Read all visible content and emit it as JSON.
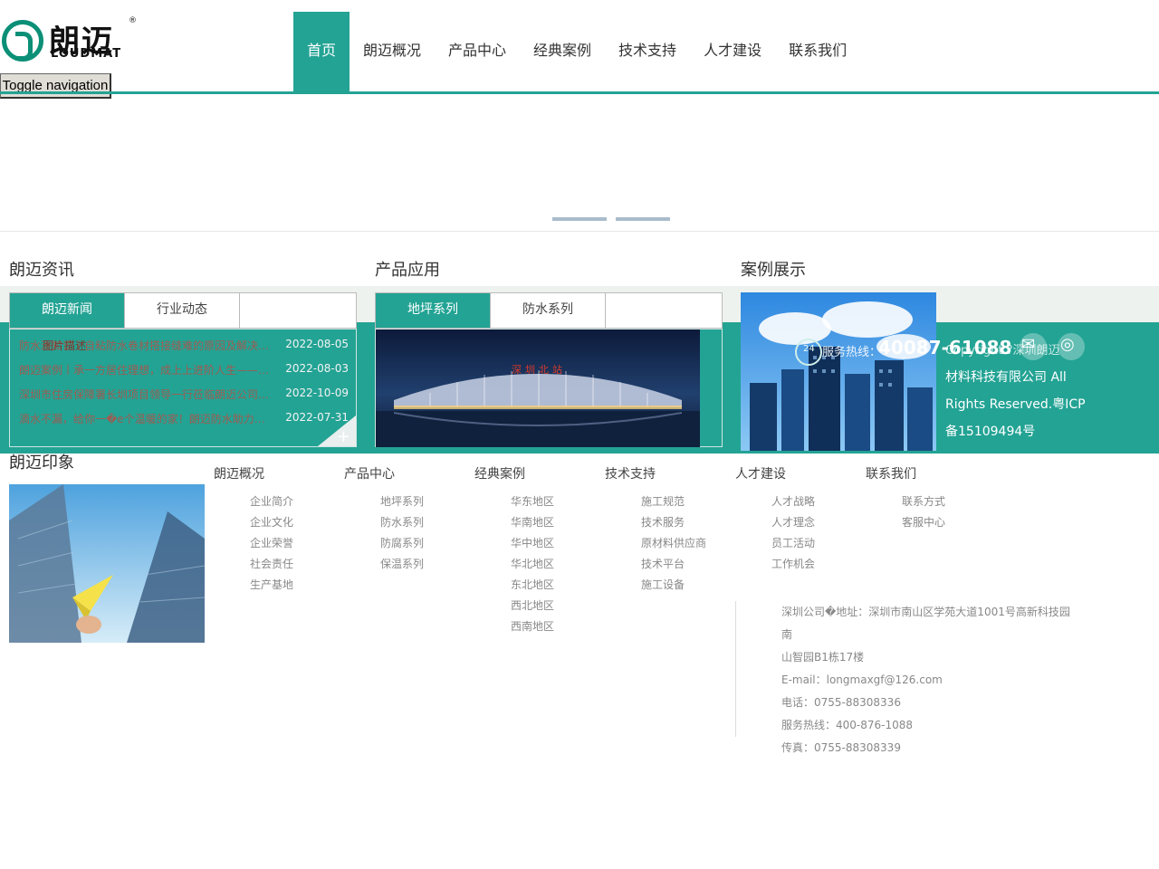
{
  "brand": {
    "name_cn": "朗迈",
    "name_en": "LOUDMAT",
    "reg": "®"
  },
  "toggle_label": "Toggle navigation",
  "nav": [
    "首页",
    "朗迈概况",
    "产品中心",
    "经典案例",
    "技术支持",
    "人才建设",
    "联系我们"
  ],
  "sections": {
    "news_title": "朗迈资讯",
    "product_title": "产品应用",
    "cases_title": "案例展示",
    "impression_title": "朗迈印象"
  },
  "news_tabs": [
    "朗迈新闻",
    "行业动态"
  ],
  "product_tabs": [
    "地坪系列",
    "防水系列"
  ],
  "news": [
    {
      "title": "防水涨知识丨自粘防水卷材搭接缝难的原因及解决方法",
      "date": "2022-08-05"
    },
    {
      "title": "朗迈案例丨承一方居住理想，成上上进阶人生——朗迈防水",
      "date": "2022-08-03"
    },
    {
      "title": "深圳市住房保障署长圳项目领导一行莅临朗迈公司考察",
      "date": "2022-10-09"
    },
    {
      "title": "滴水不漏，给你一�e个温暖的家！朗迈防水助力美好生活",
      "date": "2022-07-31"
    }
  ],
  "news_overlay": "图片描述",
  "product_image_caption": "深圳北站",
  "overlay": {
    "hotline_label": "服务热线：",
    "hotline": "40087-61088",
    "badge_24": "24",
    "copyright_1": "Copyright ?深圳朗迈",
    "copyright_2": "材料科技有限公司 All",
    "copyright_3": "Rights Reserved.粤ICP",
    "copyright_4": "备15109494号"
  },
  "footer_cols": [
    {
      "head": "朗迈概况",
      "links": [
        "企业简介",
        "企业文化",
        "企业荣誉",
        "社会责任",
        "生产基地"
      ]
    },
    {
      "head": "产品中心",
      "links": [
        "地坪系列",
        "防水系列",
        "防腐系列",
        "保温系列"
      ]
    },
    {
      "head": "经典案例",
      "links": [
        "华东地区",
        "华南地区",
        "华中地区",
        "华北地区",
        "东北地区",
        "西北地区",
        "西南地区"
      ]
    },
    {
      "head": "技术支持",
      "links": [
        "施工规范",
        "技术服务",
        "原材料供应商",
        "技术平台",
        "施工设备"
      ]
    },
    {
      "head": "人才建设",
      "links": [
        "人才战略",
        "人才理念",
        "员工活动",
        "工作机会"
      ]
    },
    {
      "head": "联系我们",
      "links": [
        "联系方式",
        "客服中心"
      ]
    }
  ],
  "contact": [
    "深圳公司�地址：深圳市南山区学苑大道1001号高新科技园南",
    "山智园B1栋17楼",
    "E-mail：longmaxgf@126.com",
    "电话：0755-88308336",
    "服务热线：400-876-1088",
    "传真：0755-88308339"
  ],
  "colors": {
    "accent": "#23a394",
    "news_text": "#c5453c"
  }
}
